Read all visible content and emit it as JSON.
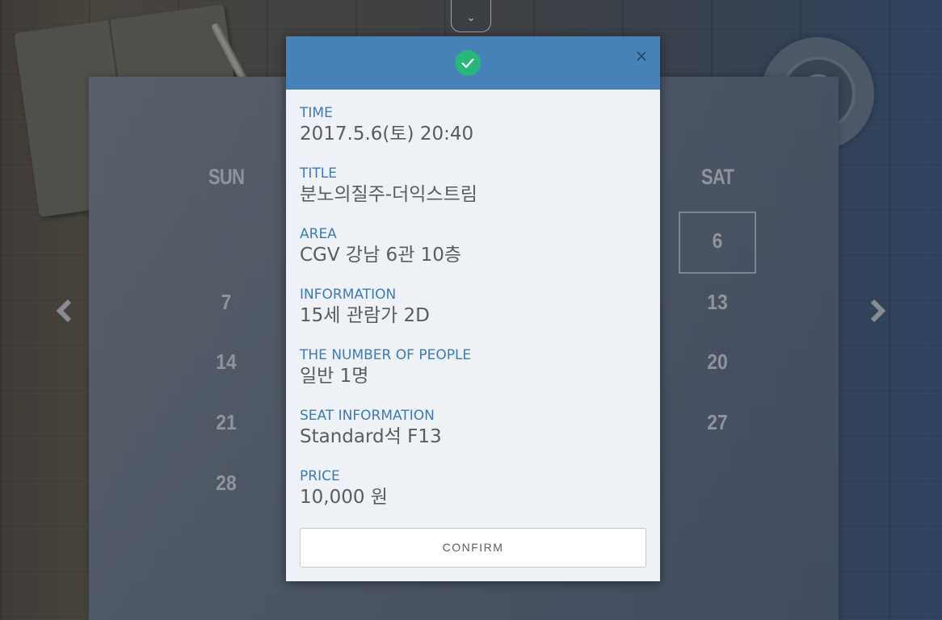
{
  "calendar": {
    "headers": {
      "sun": "SUN",
      "sat": "SAT"
    },
    "sun_column": [
      "7",
      "14",
      "21",
      "28"
    ],
    "sat_column": [
      "6",
      "13",
      "20",
      "27"
    ],
    "selected_day": "6",
    "prev_arrow": "‹",
    "next_arrow": "›"
  },
  "toggle_icon": "⌄",
  "modal": {
    "status_icon": "check-icon",
    "close_label": "×",
    "fields": [
      {
        "label": "TIME",
        "value": "2017.5.6(토) 20:40"
      },
      {
        "label": "TITLE",
        "value": "분노의질주-더익스트림"
      },
      {
        "label": "AREA",
        "value": "CGV 강남 6관 10층"
      },
      {
        "label": "INFORMATION",
        "value": "15세 관람가 2D"
      },
      {
        "label": "THE NUMBER OF PEOPLE",
        "value": "일반 1명"
      },
      {
        "label": "SEAT INFORMATION",
        "value": "Standard석 F13"
      },
      {
        "label": "PRICE",
        "value": "10,000 원"
      }
    ],
    "confirm_label": "CONFIRM"
  },
  "colors": {
    "header_blue": "#4682b8",
    "check_green": "#28b67a",
    "label_blue": "#3d7ab6",
    "value_gray": "#575c61"
  }
}
